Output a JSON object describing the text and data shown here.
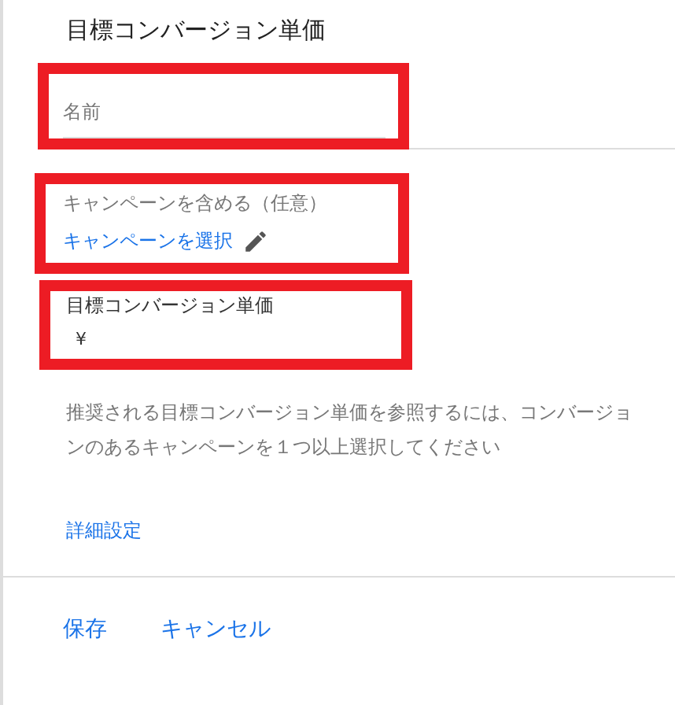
{
  "title": "目標コンバージョン単価",
  "name_field": {
    "placeholder": "名前"
  },
  "campaign": {
    "label": "キャンペーンを含める（任意）",
    "link": "キャンペーンを選択"
  },
  "cpa_field": {
    "label": "目標コンバージョン単価",
    "value": "¥"
  },
  "help_text_lines": [
    "推奨される目標コンバージョン単価を参照するには、コンバージョ",
    "ンのあるキャンペーンを１つ以上選択してください"
  ],
  "advanced_link": "詳細設定",
  "buttons": [
    "保存",
    "キャンセル"
  ]
}
